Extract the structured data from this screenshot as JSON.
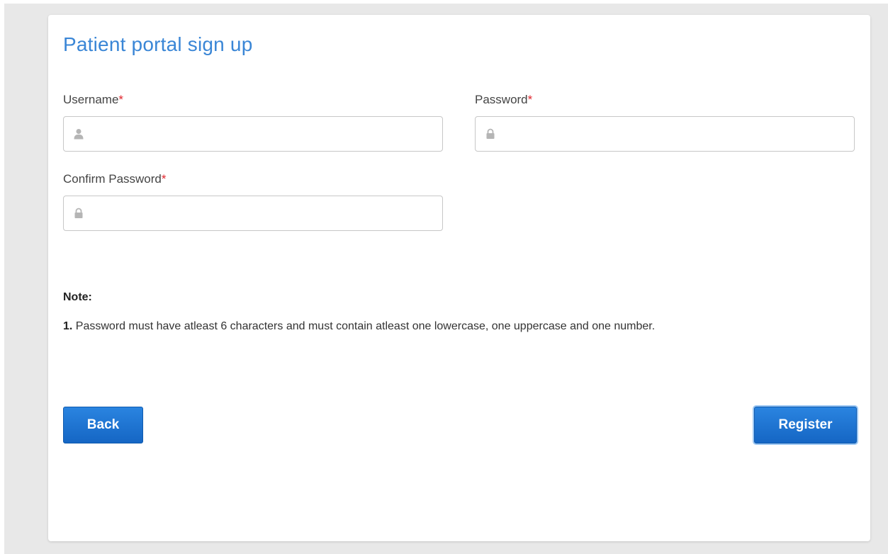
{
  "form": {
    "title": "Patient portal sign up",
    "required_marker": "*",
    "username": {
      "label": "Username",
      "value": "",
      "icon": "user-icon"
    },
    "password": {
      "label": "Password",
      "value": "",
      "icon": "lock-icon"
    },
    "confirm_password": {
      "label": "Confirm Password",
      "value": "",
      "icon": "lock-icon"
    }
  },
  "note": {
    "heading": "Note:",
    "items": [
      {
        "number": "1.",
        "text": "Password must have atleast 6 characters and must contain atleast one lowercase, one uppercase and one number."
      }
    ]
  },
  "buttons": {
    "back_label": "Back",
    "register_label": "Register"
  },
  "colors": {
    "title": "#3a86d6",
    "required": "#e0262d",
    "button": "#1a6fd0",
    "background": "#e8e8e8"
  }
}
